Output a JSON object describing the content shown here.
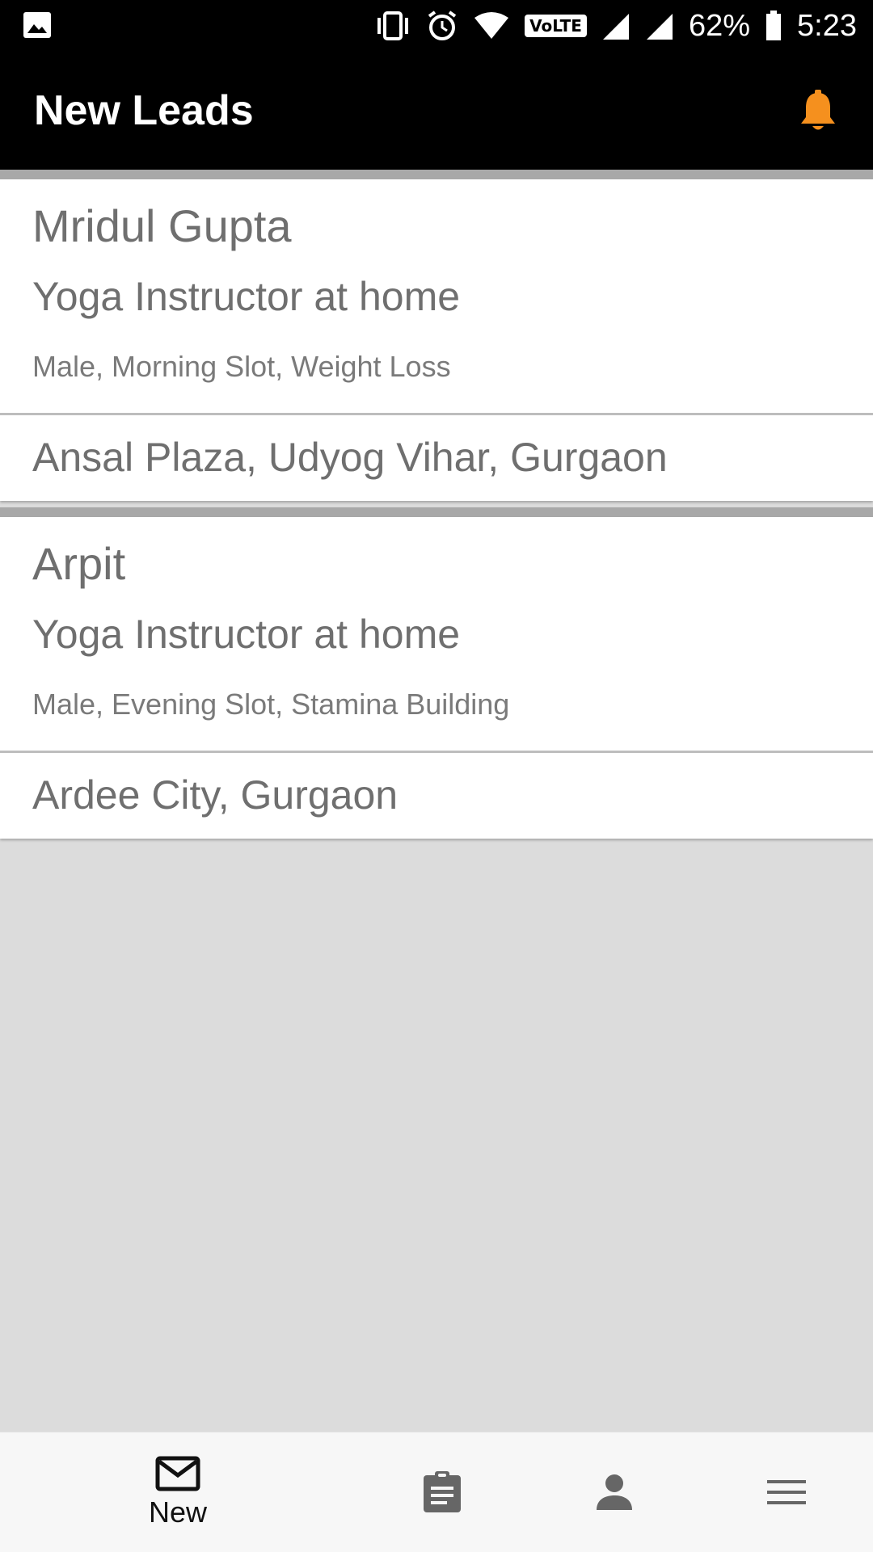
{
  "status_bar": {
    "battery_percent": "62%",
    "time": "5:23",
    "network_badge": "VoLTE",
    "icons": [
      "image-icon",
      "vibrate-icon",
      "alarm-icon",
      "wifi-icon",
      "volte-icon",
      "signal-icon",
      "signal-icon",
      "battery-icon"
    ]
  },
  "app_bar": {
    "title": "New Leads",
    "bell_icon": "bell-icon",
    "bell_color": "#f5901e"
  },
  "leads": [
    {
      "name": "Mridul Gupta",
      "service": "Yoga Instructor at home",
      "details": "Male, Morning Slot, Weight Loss",
      "location": "Ansal Plaza, Udyog Vihar, Gurgaon"
    },
    {
      "name": "Arpit",
      "service": "Yoga Instructor at home",
      "details": "Male, Evening Slot, Stamina Building",
      "location": "Ardee City, Gurgaon"
    }
  ],
  "bottom_nav": {
    "items": [
      {
        "icon": "mail-icon",
        "label": "New",
        "active": true
      },
      {
        "icon": "clipboard-icon",
        "label": ""
      },
      {
        "icon": "person-icon",
        "label": ""
      },
      {
        "icon": "menu-icon",
        "label": ""
      }
    ]
  },
  "colors": {
    "app_bar_bg": "#000000",
    "content_bg": "#dcdcdc",
    "card_bg": "#ffffff",
    "text_gray": "#6f6f6f",
    "accent_orange": "#f5901e"
  }
}
